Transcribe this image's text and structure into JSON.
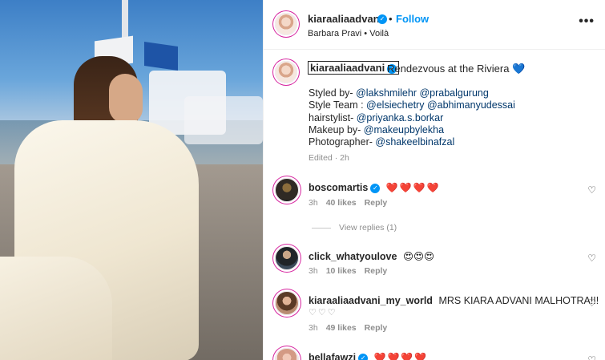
{
  "post": {
    "author": "kiaraaliaadvani",
    "follow_label": "Follow",
    "dot": "•",
    "subtitle": "Barbara Pravi • Voilà",
    "more_icon": "more-dots-icon"
  },
  "caption": {
    "author": "kiaraaliaadvani",
    "first_line": "Rendezvous at the Riviera",
    "heart": "💙",
    "lines": [
      {
        "label": "Styled by- ",
        "links": "@lakshmilehr @prabalgurung"
      },
      {
        "label": "Style Team : ",
        "links": "@elsiechetry @abhimanyudessai"
      },
      {
        "label": "hairstylist- ",
        "links": "@priyanka.s.borkar"
      },
      {
        "label": "Makeup by- ",
        "links": "@makeupbylekha"
      },
      {
        "label": "Photographer- ",
        "links": "@shakeelbinafzal"
      }
    ],
    "edited": "Edited · 2h"
  },
  "comments": [
    {
      "user": "boscomartis",
      "verified": true,
      "text": "❤️❤️❤️❤️",
      "time": "3h",
      "likes": "40 likes",
      "reply": "Reply"
    },
    {
      "user": "click_whatyoulove",
      "verified": false,
      "text": "😍😍😍",
      "time": "3h",
      "likes": "10 likes",
      "reply": "Reply"
    },
    {
      "user": "kiaraaliaadvani_my_world",
      "verified": false,
      "text": "MRS KIARA ADVANI MALHOTRA!!!",
      "text2": "♡♡♡",
      "time": "3h",
      "likes": "49 likes",
      "reply": "Reply"
    },
    {
      "user": "bellafawzi",
      "verified": true,
      "text": "❤️❤️❤️❤️",
      "time": "",
      "likes": "",
      "reply": ""
    }
  ],
  "view_replies": "View replies (1)",
  "colors": {
    "accent": "#0095f6",
    "link": "#00376b",
    "muted": "#8e8e8e"
  }
}
